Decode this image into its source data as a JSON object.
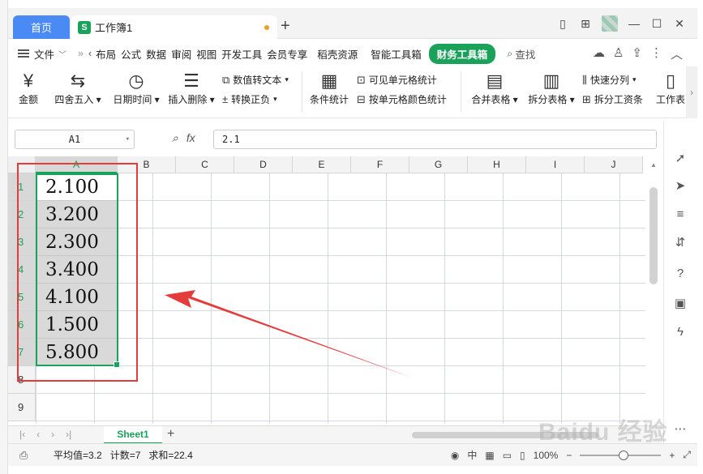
{
  "app": {
    "home_tab": "首页",
    "doc_tab": "工作簿1",
    "doc_badge": "S",
    "new_tab": "+"
  },
  "menu": {
    "file": "文件",
    "items": [
      "布局",
      "公式",
      "数据",
      "审阅",
      "视图",
      "开发工具",
      "会员专享",
      "稻壳资源",
      "智能工具箱"
    ],
    "active": "财务工具箱",
    "search": "查找"
  },
  "ribbon": {
    "amount": "金额",
    "round": "四舍五入",
    "datetime": "日期时间",
    "insert_delete": "插入删除",
    "num_to_text": "数值转文本",
    "to_positive": "转换正负",
    "cond_stats": "条件统计",
    "visible_stats": "可见单元格统计",
    "color_stats": "按单元格颜色统计",
    "merge_table": "合并表格",
    "split_table": "拆分表格",
    "quick_split": "快速分列",
    "split_pay": "拆分工资条",
    "worksheet": "工作表"
  },
  "formula": {
    "cell_ref": "A1",
    "value": "2.1"
  },
  "grid": {
    "columns": [
      "A",
      "B",
      "C",
      "D",
      "E",
      "F",
      "G",
      "H",
      "I",
      "J"
    ],
    "rows": [
      "1",
      "2",
      "3",
      "4",
      "5",
      "6",
      "7",
      "8",
      "9"
    ],
    "column_a": [
      "2.100",
      "3.200",
      "2.300",
      "3.400",
      "4.100",
      "1.500",
      "5.800"
    ]
  },
  "sheets": {
    "active": "Sheet1"
  },
  "status": {
    "average": "平均值=3.2",
    "count": "计数=7",
    "sum": "求和=22.4",
    "zoom": "100%"
  },
  "watermark": "Baidu 经验",
  "colors": {
    "accent_green": "#1aa25a",
    "home_blue": "#4a8af4",
    "annotation_red": "#e43b3b"
  }
}
